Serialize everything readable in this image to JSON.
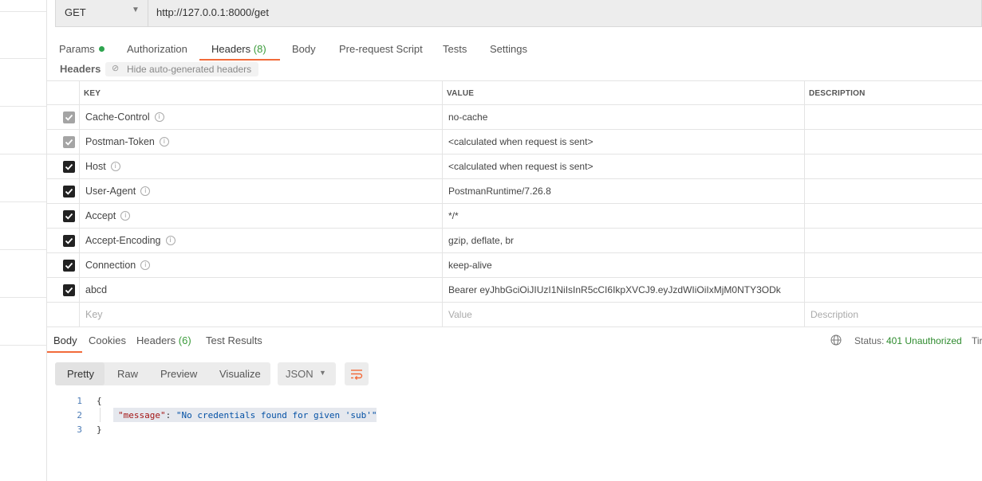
{
  "request": {
    "method": "GET",
    "url": "http://127.0.0.1:8000/get"
  },
  "request_tabs": [
    {
      "label": "Params",
      "dot": true
    },
    {
      "label": "Authorization"
    },
    {
      "label": "Headers",
      "count": "(8)",
      "active": true
    },
    {
      "label": "Body"
    },
    {
      "label": "Pre-request Script"
    },
    {
      "label": "Tests"
    },
    {
      "label": "Settings"
    }
  ],
  "headers_section": {
    "title": "Headers",
    "hide_auto_label": "Hide auto-generated headers"
  },
  "headers_table": {
    "columns": {
      "key": "KEY",
      "value": "VALUE",
      "description": "DESCRIPTION"
    },
    "rows": [
      {
        "key": "Cache-Control",
        "value": "no-cache",
        "checked": true,
        "auto": true,
        "info": true
      },
      {
        "key": "Postman-Token",
        "value": "<calculated when request is sent>",
        "checked": true,
        "auto": true,
        "info": true
      },
      {
        "key": "Host",
        "value": "<calculated when request is sent>",
        "checked": true,
        "info": true
      },
      {
        "key": "User-Agent",
        "value": "PostmanRuntime/7.26.8",
        "checked": true,
        "info": true
      },
      {
        "key": "Accept",
        "value": "*/*",
        "checked": true,
        "info": true
      },
      {
        "key": "Accept-Encoding",
        "value": "gzip, deflate, br",
        "checked": true,
        "info": true
      },
      {
        "key": "Connection",
        "value": "keep-alive",
        "checked": true,
        "info": true
      },
      {
        "key": "abcd",
        "value": "Bearer eyJhbGciOiJIUzI1NiIsInR5cCI6IkpXVCJ9.eyJzdWIiOiIxMjM0NTY3ODk",
        "checked": true,
        "info": false
      }
    ],
    "placeholder": {
      "key": "Key",
      "value": "Value",
      "description": "Description"
    }
  },
  "response_tabs": [
    {
      "label": "Body",
      "active": true
    },
    {
      "label": "Cookies"
    },
    {
      "label": "Headers",
      "count": "(6)"
    },
    {
      "label": "Test Results"
    }
  ],
  "response_status": {
    "label": "Status:",
    "value": "401 Unauthorized",
    "time_label": "Tir"
  },
  "view_modes": [
    "Pretty",
    "Raw",
    "Preview",
    "Visualize"
  ],
  "format": "JSON",
  "response_body": {
    "line_numbers": [
      "1",
      "2",
      "3"
    ],
    "open_brace": "{",
    "key": "\"message\"",
    "colon": ": ",
    "value": "\"No credentials found for given 'sub'\"",
    "close_brace": "}"
  },
  "colors": {
    "accent": "#f26b3a",
    "status_ok": "#3a9b3a"
  }
}
